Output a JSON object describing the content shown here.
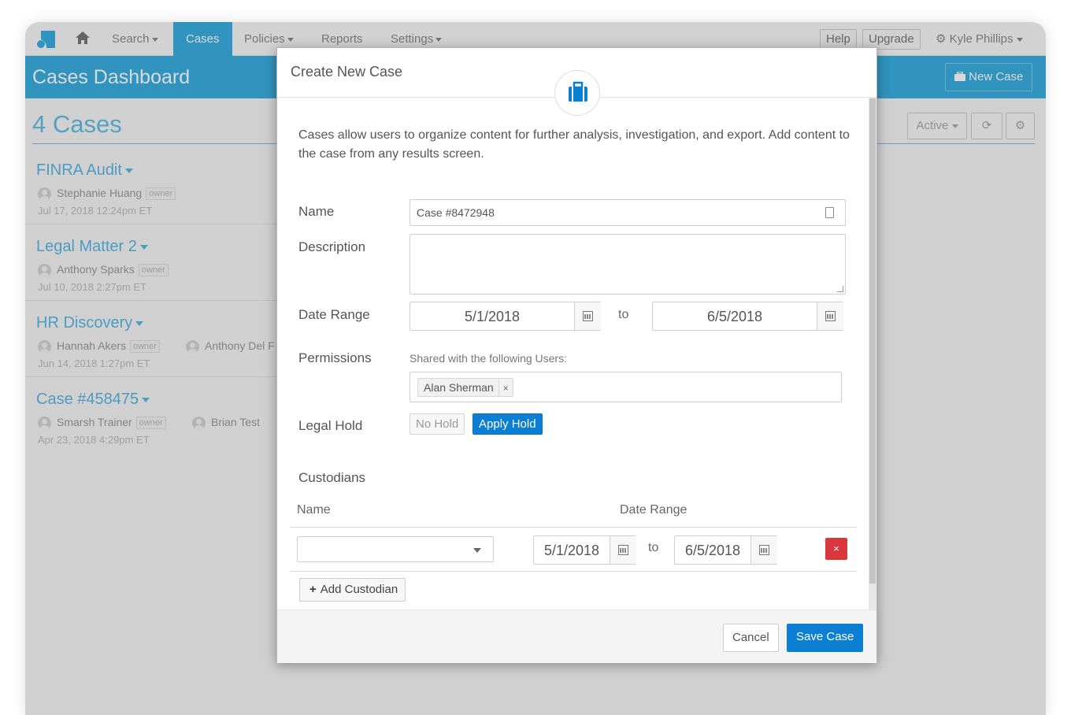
{
  "nav": {
    "items": [
      "Search",
      "Cases",
      "Policies",
      "Reports",
      "Settings"
    ],
    "help": "Help",
    "upgrade": "Upgrade",
    "user": "Kyle Phillips"
  },
  "header": {
    "title": "Cases Dashboard",
    "new_case": "New Case"
  },
  "page": {
    "cases_count": "4 Cases",
    "active_filter": "Active"
  },
  "cases": [
    {
      "title": "FINRA Audit",
      "users": [
        {
          "name": "Stephanie Huang",
          "badge": "owner"
        }
      ],
      "date": "Jul 17, 2018 12:24pm ET"
    },
    {
      "title": "Legal Matter 2",
      "users": [
        {
          "name": "Anthony Sparks",
          "badge": "owner"
        }
      ],
      "date": "Jul 10, 2018 2:27pm ET"
    },
    {
      "title": "HR Discovery",
      "users": [
        {
          "name": "Hannah Akers",
          "badge": "owner"
        },
        {
          "name": "Anthony Del F",
          "badge": ""
        }
      ],
      "date": "Jun 14, 2018 1:27pm ET"
    },
    {
      "title": "Case #458475",
      "users": [
        {
          "name": "Smarsh Trainer",
          "badge": "owner"
        },
        {
          "name": "Brian Test",
          "badge": ""
        }
      ],
      "date": "Apr 23, 2018 4:29pm ET"
    }
  ],
  "modal": {
    "title": "Create New Case",
    "intro": "Cases allow users to organize content for further analysis, investigation, and export. Add content to the case from any results screen.",
    "name_label": "Name",
    "name_value": "Case #8472948",
    "description_label": "Description",
    "description_value": "",
    "date_range_label": "Date Range",
    "date_from": "5/1/2018",
    "to_text": "to",
    "date_to": "6/5/2018",
    "permissions_label": "Permissions",
    "shared_label": "Shared with the following Users:",
    "shared_user": "Alan Sherman",
    "tag_remove": "×",
    "legal_hold_label": "Legal Hold",
    "no_hold": "No Hold",
    "apply_hold": "Apply Hold",
    "custodians_label": "Custodians",
    "col_name": "Name",
    "col_date_range": "Date Range",
    "custodian": {
      "name": "",
      "date_from": "5/1/2018",
      "to_text": "to",
      "date_to": "6/5/2018",
      "delete": "×"
    },
    "add_custodian": "Add Custodian",
    "cancel": "Cancel",
    "save": "Save Case"
  },
  "colors": {
    "brand_blue": "#3aaee0",
    "primary_button": "#0a7fd4",
    "danger": "#d9373b"
  }
}
